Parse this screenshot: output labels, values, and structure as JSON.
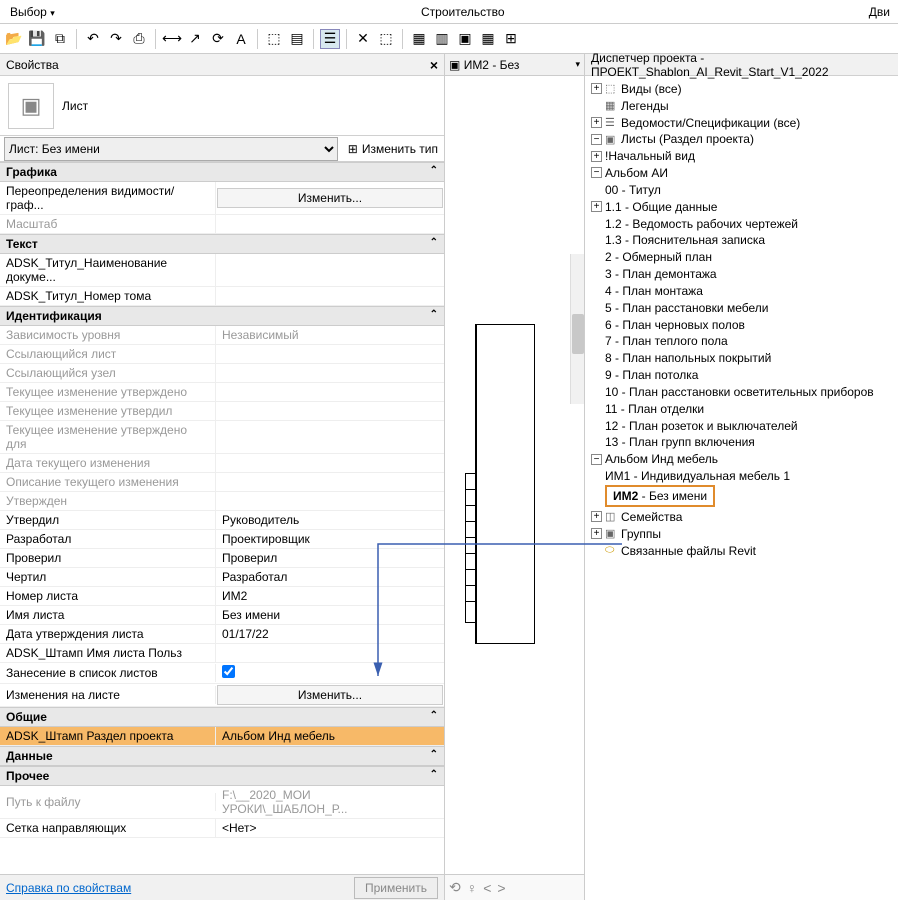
{
  "top": {
    "vbor": "Выбор",
    "center": "Строительство",
    "right": "Дви"
  },
  "properties_panel": {
    "title": "Свойства",
    "type_label": "Лист",
    "list_select": "Лист: Без имени",
    "edit_type": "Изменить тип",
    "sections": {
      "graphics": "Графика",
      "text": "Текст",
      "ident": "Идентификация",
      "common": "Общие",
      "data": "Данные",
      "other": "Прочее"
    },
    "rows": {
      "r1k": "Переопределения видимости/граф...",
      "r1v": "Изменить...",
      "r2k": "Масштаб",
      "r3k": "ADSK_Титул_Наименование докуме...",
      "r4k": "ADSK_Титул_Номер тома",
      "r5k": "Зависимость уровня",
      "r5v": "Независимый",
      "r6k": "Ссылающийся лист",
      "r7k": "Ссылающийся узел",
      "r8k": "Текущее изменение утверждено",
      "r9k": "Текущее изменение утвердил",
      "r10k": "Текущее изменение утверждено для",
      "r11k": "Дата текущего изменения",
      "r12k": "Описание текущего изменения",
      "r13k": "Утвержден",
      "r14k": "Утвердил",
      "r14v": "Руководитель",
      "r15k": "Разработал",
      "r15v": "Проектировщик",
      "r16k": "Проверил",
      "r16v": "Проверил",
      "r17k": "Чертил",
      "r17v": "Разработал",
      "r18k": "Номер листа",
      "r18v": "ИМ2",
      "r19k": "Имя листа",
      "r19v": "Без имени",
      "r20k": "Дата утверждения листа",
      "r20v": "01/17/22",
      "r21k": "ADSK_Штамп Имя листа Польз",
      "r22k": "Занесение в список листов",
      "r23k": "Изменения на листе",
      "r23v": "Изменить...",
      "r24k": "ADSK_Штамп Раздел проекта",
      "r24v": "Альбом Инд мебель",
      "r25k": "Путь к файлу",
      "r25v": "F:\\__2020_МОИ УРОКИ\\_ШАБЛОН_Р...",
      "r26k": "Сетка направляющих",
      "r26v": "<Нет>"
    },
    "footer_link": "Справка по свойствам",
    "apply": "Применить"
  },
  "mid": {
    "tab": "ИМ2 - Без"
  },
  "browser": {
    "title": "Диспетчер проекта - ПРОЕКТ_Shablon_AI_Revit_Start_V1_2022",
    "nodes": {
      "views": "Виды (все)",
      "legends": "Легенды",
      "schedules": "Ведомости/Спецификации (все)",
      "sheets": "Листы (Раздел проекта)",
      "start": "!Начальный вид",
      "album_ai": "Альбом АИ",
      "s00": "00 - Титул",
      "s11": "1.1 - Общие данные",
      "s12": "1.2 - Ведомость рабочих чертежей",
      "s13": "1.3 - Пояснительная записка",
      "s2": "2 - Обмерный план",
      "s3": "3 - План демонтажа",
      "s4": "4 - План монтажа",
      "s5": "5 - План расстановки мебели",
      "s6": "6 - План черновых полов",
      "s7": "7 - План теплого пола",
      "s8": "8 - План напольных покрытий",
      "s9": "9 - План потолка",
      "s10": "10 - План расстановки осветительных приборов",
      "s11b": "11 - План отделки",
      "s12b": "12 - План розеток и выключателей",
      "s13b": "13 - План групп включения",
      "album_ind": "Альбом Инд мебель",
      "im1": "ИМ1 - Индивидуальная мебель 1",
      "im2_bold": "ИМ2",
      "im2_rest": " - Без имени",
      "families": "Семейства",
      "groups": "Группы",
      "links": "Связанные файлы Revit"
    }
  }
}
